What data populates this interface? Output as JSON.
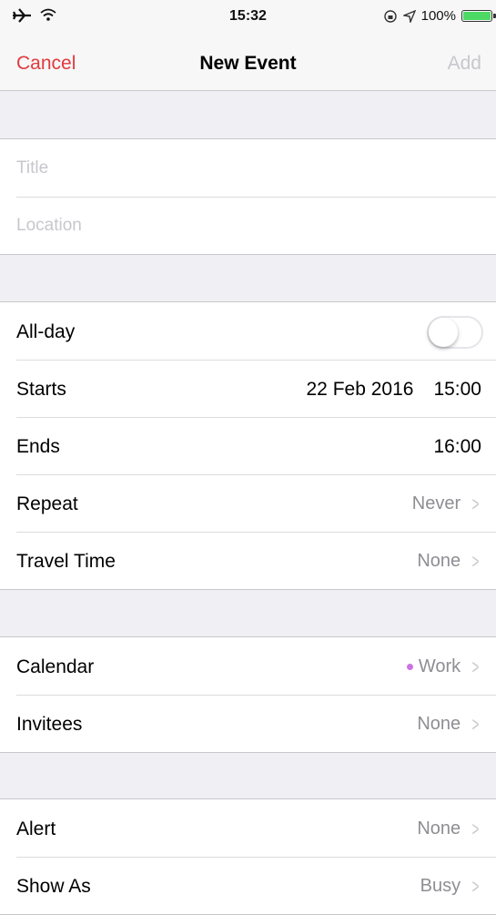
{
  "status_bar": {
    "time": "15:32",
    "battery_text": "100%",
    "icons": [
      "airplane-icon",
      "wifi-icon",
      "lock-rotation-icon",
      "location-icon",
      "battery-icon"
    ]
  },
  "nav": {
    "cancel_label": "Cancel",
    "title": "New Event",
    "add_label": "Add"
  },
  "title_group": {
    "title_placeholder": "Title",
    "location_placeholder": "Location"
  },
  "time_group": {
    "allday_label": "All-day",
    "allday_on": false,
    "starts_label": "Starts",
    "starts_date": "22 Feb 2016",
    "starts_time": "15:00",
    "ends_label": "Ends",
    "ends_time": "16:00",
    "repeat_label": "Repeat",
    "repeat_value": "Never",
    "travel_label": "Travel Time",
    "travel_value": "None"
  },
  "calendar_group": {
    "calendar_label": "Calendar",
    "calendar_value": "Work",
    "calendar_color": "#cc73e1",
    "invitees_label": "Invitees",
    "invitees_value": "None"
  },
  "alert_group": {
    "alert_label": "Alert",
    "alert_value": "None",
    "show_as_label": "Show As",
    "show_as_value": "Busy"
  },
  "colors": {
    "accent_red": "#e03a3e",
    "disabled_gray": "#c7c7cc",
    "background": "#efeff4"
  }
}
